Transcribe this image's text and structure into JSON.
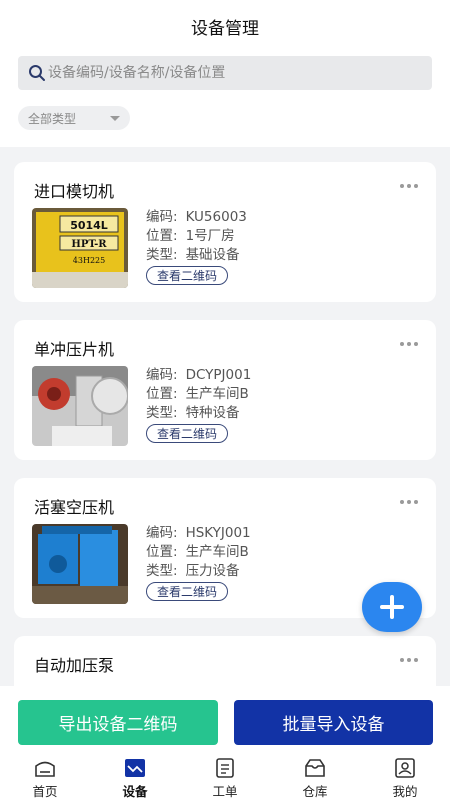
{
  "header": {
    "title": "设备管理"
  },
  "search": {
    "placeholder": "设备编码/设备名称/设备位置"
  },
  "filter": {
    "selected": "全部类型"
  },
  "equipment": [
    {
      "name": "进口模切机",
      "code_label": "编码:",
      "code": "KU56003",
      "location_label": "位置:",
      "location": "1号厂房",
      "type_label": "类型:",
      "type": "基础设备",
      "qr_label": "查看二维码",
      "image_text": [
        "5014L",
        "HPT-R",
        "43H225"
      ]
    },
    {
      "name": "单冲压片机",
      "code_label": "编码:",
      "code": "DCYPJ001",
      "location_label": "位置:",
      "location": "生产车间B",
      "type_label": "类型:",
      "type": "特种设备",
      "qr_label": "查看二维码"
    },
    {
      "name": "活塞空压机",
      "code_label": "编码:",
      "code": "HSKYJ001",
      "location_label": "位置:",
      "location": "生产车间B",
      "type_label": "类型:",
      "type": "压力设备",
      "qr_label": "查看二维码"
    },
    {
      "name": "自动加压泵"
    }
  ],
  "actions": {
    "export_label": "导出设备二维码",
    "import_label": "批量导入设备"
  },
  "tabs": [
    {
      "label": "首页",
      "icon": "home-icon"
    },
    {
      "label": "设备",
      "icon": "equipment-icon",
      "active": true
    },
    {
      "label": "工单",
      "icon": "work-order-icon"
    },
    {
      "label": "仓库",
      "icon": "warehouse-icon"
    },
    {
      "label": "我的",
      "icon": "profile-icon"
    }
  ],
  "colors": {
    "accent_green": "#26c48f",
    "accent_navy": "#1233a6",
    "fab_blue": "#2b86ef"
  }
}
